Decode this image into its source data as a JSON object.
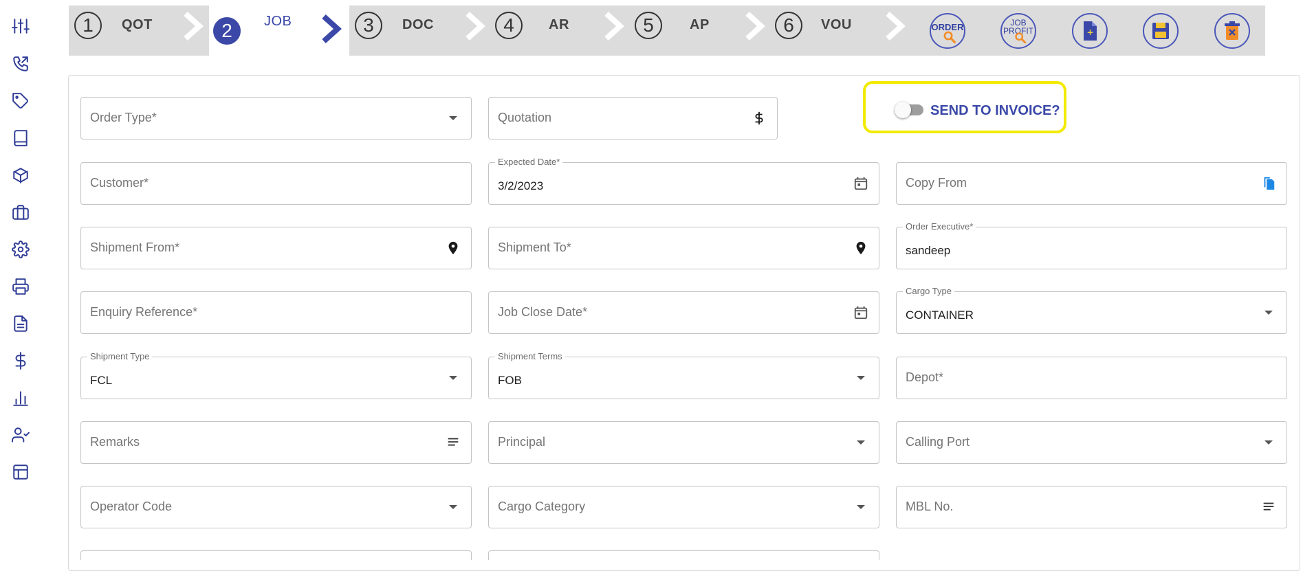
{
  "sidebar": {
    "icons": [
      "sliders-icon",
      "phone-icon",
      "tag-icon",
      "book-icon",
      "cube-icon",
      "briefcase-icon",
      "gear-icon",
      "printer-icon",
      "document-icon",
      "dollar-icon",
      "bar-chart-icon",
      "user-check-icon",
      "layout-icon"
    ]
  },
  "stepper": {
    "steps": [
      {
        "num": "1",
        "label": "QOT"
      },
      {
        "num": "2",
        "label": "JOB"
      },
      {
        "num": "3",
        "label": "DOC"
      },
      {
        "num": "4",
        "label": "AR"
      },
      {
        "num": "5",
        "label": "AP"
      },
      {
        "num": "6",
        "label": "VOU"
      }
    ],
    "active_step": "2",
    "tools": {
      "order": "ORDER",
      "job_profit_line1": "JOB",
      "job_profit_line2": "PROFIT"
    }
  },
  "toggle": {
    "label": "SEND TO INVOICE?",
    "checked": false
  },
  "form": {
    "order_type": {
      "placeholder": "Order Type*"
    },
    "quotation": {
      "placeholder": "Quotation"
    },
    "customer": {
      "placeholder": "Customer*"
    },
    "expected_date": {
      "label": "Expected Date*",
      "value": "3/2/2023"
    },
    "copy_from": {
      "placeholder": "Copy From"
    },
    "shipment_from": {
      "placeholder": "Shipment From*"
    },
    "shipment_to": {
      "placeholder": "Shipment To*"
    },
    "order_executive": {
      "label": "Order Executive*",
      "value": "sandeep"
    },
    "enquiry_reference": {
      "placeholder": "Enquiry Reference*"
    },
    "job_close_date": {
      "placeholder": "Job Close Date*"
    },
    "cargo_type": {
      "label": "Cargo Type",
      "value": "CONTAINER"
    },
    "shipment_type": {
      "label": "Shipment Type",
      "value": "FCL"
    },
    "shipment_terms": {
      "label": "Shipment Terms",
      "value": "FOB"
    },
    "depot": {
      "placeholder": "Depot*"
    },
    "remarks": {
      "placeholder": "Remarks"
    },
    "principal": {
      "placeholder": "Principal"
    },
    "calling_port": {
      "placeholder": "Calling Port"
    },
    "operator_code": {
      "placeholder": "Operator Code"
    },
    "cargo_category": {
      "placeholder": "Cargo Category"
    },
    "mbl_no": {
      "placeholder": "MBL No."
    }
  },
  "colors": {
    "accent": "#3b48a8",
    "stepbar_bg": "#dcdcdc",
    "highlight": "#f2ea00",
    "copy_icon": "#1e88e5"
  }
}
